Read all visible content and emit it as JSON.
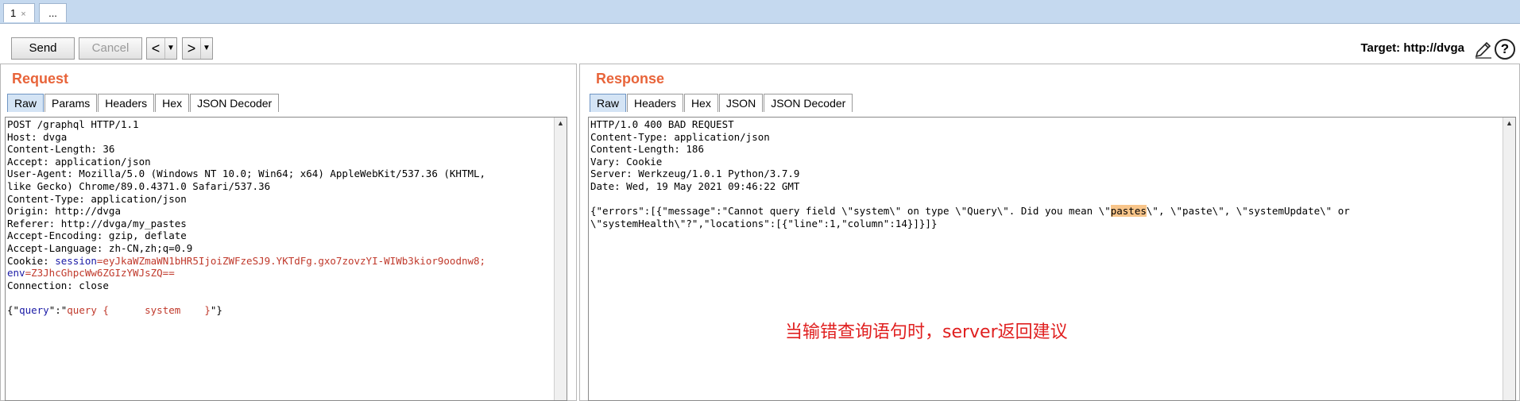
{
  "top_tabs": [
    {
      "label": "1",
      "close": "×"
    },
    {
      "label": "..."
    }
  ],
  "toolbar": {
    "send": "Send",
    "cancel": "Cancel",
    "back": "<",
    "fwd": ">",
    "dropdown": "▼",
    "target": "Target: http://dvga",
    "help": "?"
  },
  "request": {
    "title": "Request",
    "tabs": [
      "Raw",
      "Params",
      "Headers",
      "Hex",
      "JSON Decoder"
    ],
    "lines": [
      "POST /graphql HTTP/1.1",
      "Host: dvga",
      "Content-Length: 36",
      "Accept: application/json",
      "User-Agent: Mozilla/5.0 (Windows NT 10.0; Win64; x64) AppleWebKit/537.36 (KHTML,",
      "like Gecko) Chrome/89.0.4371.0 Safari/537.36",
      "Content-Type: application/json",
      "Origin: http://dvga",
      "Referer: http://dvga/my_pastes",
      "Accept-Encoding: gzip, deflate",
      "Accept-Language: zh-CN,zh;q=0.9"
    ],
    "cookie_prefix": "Cookie: ",
    "cookie_k1": "session",
    "cookie_v1": "=eyJkaWZmaWN1bHR5IjoiZWFzeSJ9.YKTdFg.gxo7zovzYI-WIWb3kior9oodnw8;",
    "cookie_k2": "env",
    "cookie_v2": "=Z3JhcGhpcWw6ZGIzYWJsZQ==",
    "connection": "Connection: close",
    "body_pre": "{\"",
    "body_key": "query",
    "body_mid": "\":\"",
    "body_val": "query {      system    }",
    "body_post": "\"}"
  },
  "response": {
    "title": "Response",
    "tabs": [
      "Raw",
      "Headers",
      "Hex",
      "JSON",
      "JSON Decoder"
    ],
    "lines": [
      "HTTP/1.0 400 BAD REQUEST",
      "Content-Type: application/json",
      "Content-Length: 186",
      "Vary: Cookie",
      "Server: Werkzeug/1.0.1 Python/3.7.9",
      "Date: Wed, 19 May 2021 09:46:22 GMT"
    ],
    "body1_pre": "{\"errors\":[{\"message\":\"Cannot query field \\\"system\\\" on type \\\"Query\\\". Did you mean \\\"",
    "body1_hl": "pastes",
    "body1_post": "\\\", \\\"paste\\\", \\\"systemUpdate\\\" or",
    "body2": "\\\"systemHealth\\\"?\",\"locations\":[{\"line\":1,\"column\":14}]}]}"
  },
  "annotation": "当输错查询语句时，server返回建议"
}
